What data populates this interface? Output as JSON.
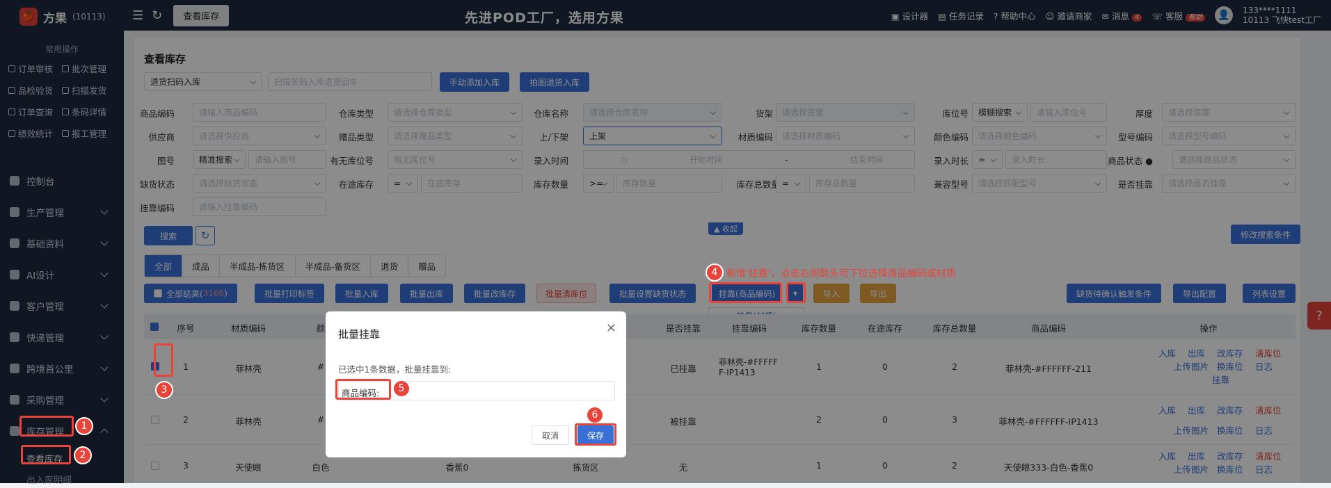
{
  "app": {
    "name": "方果",
    "id": "(10113)"
  },
  "sidebar": {
    "common_title": "常用操作",
    "quick": [
      "订单审核",
      "批次管理",
      "品检验货",
      "扫描发货",
      "订单查询",
      "条码详情",
      "绩效统计",
      "报工管理"
    ],
    "nav": [
      "控制台",
      "生产管理",
      "基础资料",
      "AI设计",
      "客户管理",
      "快递管理",
      "跨境首公里",
      "采购管理",
      "库存管理"
    ],
    "sub": [
      "查看库存",
      "出入库明细"
    ]
  },
  "topbar": {
    "tab": "查看库存",
    "slogan": "先进POD工厂，选用方果",
    "links": [
      "设计器",
      "任务记录",
      "帮助中心",
      "邀请商家",
      "消息",
      "客服"
    ],
    "msg_count": "4",
    "service_badge": "帮助",
    "user": {
      "phone": "133****1111",
      "org": "10113 飞快test工厂"
    }
  },
  "page": {
    "title": "查看库存",
    "scan_select": "退货扫码入库",
    "scan_placeholder": "扫描条码入库退货回车",
    "btn_manual": "手动添加入库",
    "btn_photo": "拍图退货入库"
  },
  "filters": {
    "row1": [
      {
        "label": "商品编码",
        "ph": "请输入商品编码"
      },
      {
        "label": "仓库类型",
        "ph": "请选择仓库类型"
      },
      {
        "label": "仓库名称",
        "ph": "请选择仓库名称"
      },
      {
        "label": "货架",
        "ph": "请选择货架"
      },
      {
        "label": "库位号",
        "ph": "模糊搜索",
        "ph2": "请输入库位号"
      },
      {
        "label": "厚度",
        "ph": "请选择厚度"
      }
    ],
    "row2": [
      {
        "label": "供应商",
        "ph": "请选择供应商"
      },
      {
        "label": "赠品类型",
        "ph": "请选择赠品类型"
      },
      {
        "label": "上/下架",
        "ph": "上架"
      },
      {
        "label": "材质编码",
        "ph": "请选择材质编码"
      },
      {
        "label": "颜色编码",
        "ph": "请选择颜色编码"
      },
      {
        "label": "型号编码",
        "ph": "请选择型号编码"
      }
    ],
    "row3": [
      {
        "label": "图号",
        "ph": "精准搜索",
        "ph2": "请输入图号"
      },
      {
        "label": "有无库位号",
        "ph": "有无库位号"
      },
      {
        "label": "录入时间",
        "ph": "开始时间",
        "ph2": "结束时间"
      },
      {
        "label": "录入时长",
        "ph": "=",
        "ph2": "录入时长"
      },
      {
        "label": "商品状态",
        "ph": "请选择商品状态"
      }
    ],
    "row4": [
      {
        "label": "缺货状态",
        "ph": "请选择缺货状态"
      },
      {
        "label": "在途库存",
        "ph": "=",
        "ph2": "在途库存"
      },
      {
        "label": "库存数量",
        "ph": ">=",
        "ph2": "库存数量"
      },
      {
        "label": "库存总数量",
        "ph": "=",
        "ph2": "库存总数量"
      },
      {
        "label": "兼容型号",
        "ph": "请选择匹配型号"
      },
      {
        "label": "是否挂靠",
        "ph": "请选择是否挂靠"
      }
    ],
    "row5": [
      {
        "label": "挂靠编码",
        "ph": "请输入挂靠编码"
      }
    ],
    "date_sep": "-",
    "search_btn": "搜索",
    "collapse": "收起",
    "edit_cond": "修改搜索条件"
  },
  "tabs": [
    "全部",
    "成品",
    "半成品-拣货区",
    "半成品-备货区",
    "退货",
    "赠品"
  ],
  "actions": {
    "all_results": "全部结果(",
    "all_count": "3166",
    "all_close": ")",
    "batch_print": "批量打印标签",
    "batch_in": "批量入库",
    "batch_out": "批量出库",
    "batch_change": "批量改库存",
    "batch_clear": "批量清库位",
    "batch_shortage": "批量设置缺货状态",
    "link": "挂靠(商品编码)",
    "link_alt": "挂靠(材质)",
    "import": "导入",
    "export": "导出",
    "shortage_cond": "缺货待确认触发条件",
    "export_cfg": "导出配置",
    "list_cfg": "列表设置"
  },
  "table": {
    "headers": [
      "序号",
      "材质编码",
      "颜",
      "是否挂靠",
      "挂靠编码",
      "库存数量",
      "在途库存",
      "库存总数量",
      "商品编码",
      "操作"
    ],
    "rows": [
      {
        "no": "1",
        "mat": "菲林壳",
        "color": "#",
        "spec": "",
        "area": "",
        "linked": "已挂靠",
        "code_a": "菲林壳-#FFFFF",
        "code_b": "F-IP1413",
        "stock": "1",
        "transit": "0",
        "total": "2",
        "sku": "菲林壳-#FFFFFF-211"
      },
      {
        "no": "2",
        "mat": "菲林壳",
        "color": "#",
        "spec": "",
        "area": "",
        "linked": "被挂靠",
        "code_a": "",
        "code_b": "",
        "stock": "2",
        "transit": "0",
        "total": "3",
        "sku": "菲林壳-#FFFFFF-IP1413"
      },
      {
        "no": "3",
        "mat": "天使眼",
        "color": "白色",
        "spec": "香蕉0",
        "area": "拣货区",
        "linked": "无",
        "code_a": "",
        "code_b": "",
        "stock": "1",
        "transit": "0",
        "total": "2",
        "sku": "天使眼333-白色-香蕉0"
      }
    ],
    "ops": {
      "in": "入库",
      "out": "出库",
      "change": "改库存",
      "clear": "清库位",
      "upload": "上传图片",
      "swap": "换库位",
      "log": "日志",
      "link": "挂靠"
    }
  },
  "dialog": {
    "title": "批量挂靠",
    "text": "已选中1条数据，批量挂靠到:",
    "field_label": "商品编码:",
    "cancel": "取消",
    "save": "保存"
  },
  "annotation": {
    "text": "新增'挂靠'，点击右侧箭头可下拉选择商品编码或材质",
    "steps": [
      "1",
      "2",
      "3",
      "4",
      "5",
      "6"
    ]
  },
  "colors": {
    "primary": "#3a6fd8",
    "sidebar": "#1e2a3f",
    "annotation": "#e8443a"
  }
}
